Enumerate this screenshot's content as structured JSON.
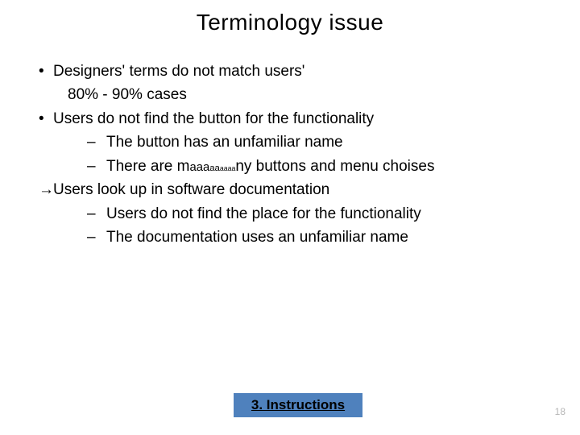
{
  "title": "Terminology issue",
  "lines": {
    "l1": "Designers' terms do not match users'",
    "l1b": "80% - 90% cases",
    "l2": "Users do not find the button for the functionality",
    "l2a": "The button has an unfamiliar name",
    "l2b_pre": "There are m",
    "l2b_a1": "aaa",
    "l2b_a2": "aa",
    "l2b_a3": "aaaa",
    "l2b_post": "ny buttons and menu choises",
    "l3": "Users look up in software documentation",
    "l3a": "Users do not find the place for the functionality",
    "l3b": "The documentation uses an unfamiliar name"
  },
  "footer": "3. Instructions",
  "page_number": "18"
}
